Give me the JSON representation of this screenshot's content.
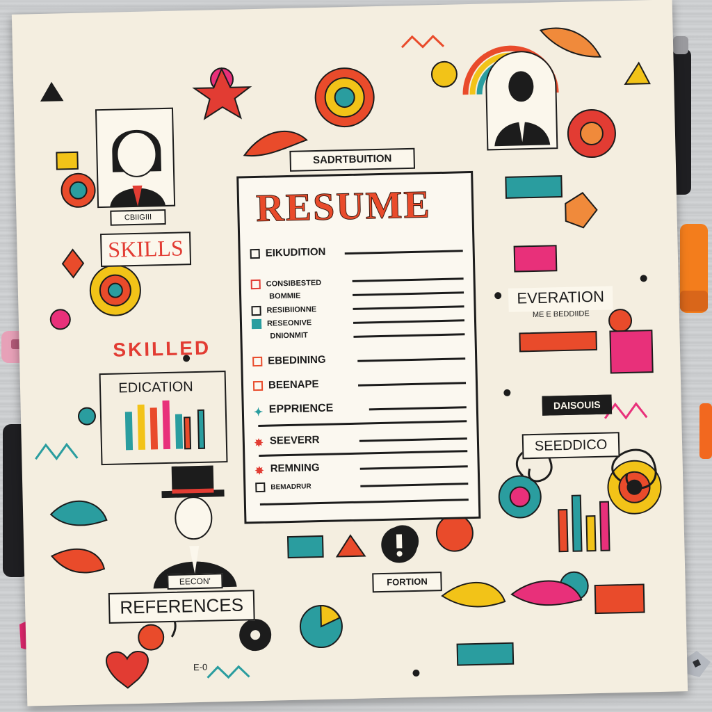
{
  "scene": {
    "description_colors": {
      "desk": "#c9cbcd",
      "paper": "#f4eee0",
      "accent_orange": "#e94b2b",
      "accent_teal": "#2a9d9f",
      "accent_pink": "#e8307a",
      "accent_yellow": "#f2c318"
    }
  },
  "paper": {
    "top_banner": "SADRTBUITION",
    "title": "RESUME",
    "rows": [
      {
        "label": "EIKUDITION"
      },
      {
        "label": "CONSIBESTED"
      },
      {
        "label": "BOMMIE"
      },
      {
        "label": "RESIBIIONNE"
      },
      {
        "label": "RESEONIVE"
      },
      {
        "label": "DNIONMIT"
      },
      {
        "label": "EBEDINING"
      },
      {
        "label": "BEENAPE"
      },
      {
        "label": "EPPRIENCE"
      },
      {
        "label": "SEEVERR"
      },
      {
        "label": "REMNING"
      },
      {
        "label": "BEMADRUR"
      }
    ],
    "left_labels": {
      "name_tag": "CBIIGIII",
      "skills": "SKILLS",
      "skilled_banner": "SKILLED",
      "education": "EDICATION",
      "references_tag": "EECON'",
      "references": "REFERENCES"
    },
    "right_labels": {
      "evernation": "EVERATION",
      "evernation_sub": "ME E BEDDIIDE",
      "daisons": "DAISOUIS",
      "seeddico": "SEEDDICO"
    },
    "bottom_labels": {
      "fortion": "FORTION",
      "bottom_left_small": "E-0"
    }
  }
}
